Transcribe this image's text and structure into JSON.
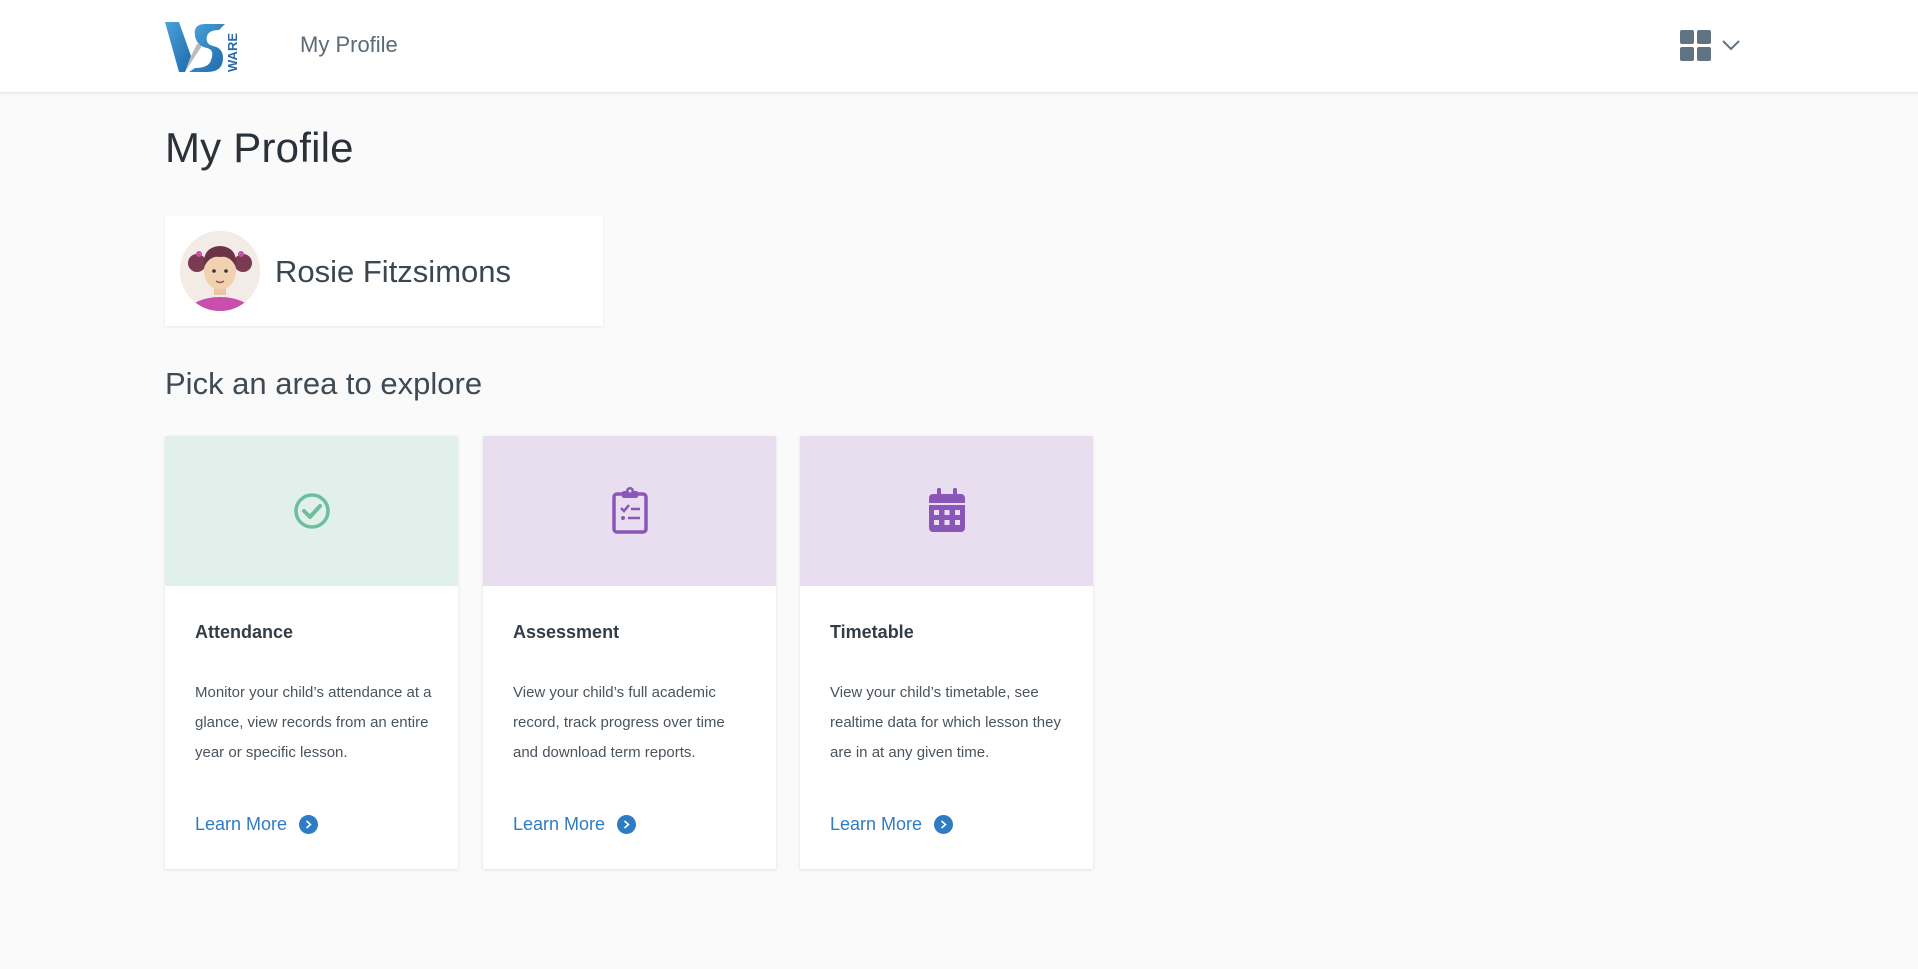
{
  "header": {
    "logo_alt": "VSware",
    "logo_text": "WARE",
    "title": "My Profile",
    "apps_icon": "grid-icon",
    "menu_icon": "chevron-down-icon"
  },
  "page": {
    "title": "My Profile"
  },
  "profile": {
    "name": "Rosie Fitzsimons",
    "avatar_icon": "girl-avatar"
  },
  "explore": {
    "title": "Pick an area to explore",
    "cards": [
      {
        "title": "Attendance",
        "description": "Monitor your child’s attendance at a glance, view records from an entire year or specific lesson.",
        "link": "Learn More",
        "icon": "check-circle-icon",
        "hero_color": "#e1f0ea",
        "icon_color": "#6bbf9f"
      },
      {
        "title": "Assessment",
        "description": "View your child’s full academic record, track progress over time and download term reports.",
        "link": "Learn More",
        "icon": "clipboard-checklist-icon",
        "hero_color": "#e9def0",
        "icon_color": "#8a56b8"
      },
      {
        "title": "Timetable",
        "description": "View your child’s timetable, see realtime data for which lesson they are in at any given time.",
        "link": "Learn More",
        "icon": "calendar-icon",
        "hero_color": "#e9def0",
        "icon_color": "#8a56b8"
      }
    ]
  },
  "colors": {
    "link": "#2e7cc4",
    "background": "#fafafa"
  }
}
